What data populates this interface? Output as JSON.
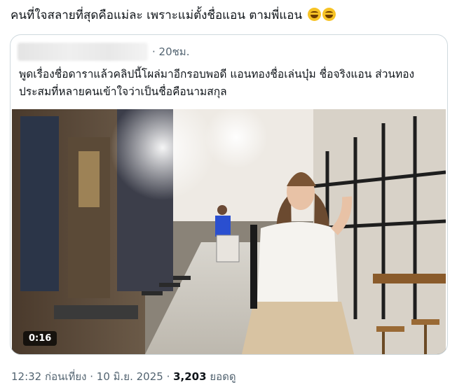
{
  "post": {
    "text": "คนที่ใจสลายที่สุดคือแม่ละ เพราะแม่ตั้งชื่อแอน ตามพี่แอน",
    "emojis": [
      "rolling-on-floor-laughing",
      "rolling-on-floor-laughing"
    ]
  },
  "quote": {
    "time": "· 20ชม.",
    "text": "พูดเรื่องชื่อดาราแล้วคลิปนี้โผล่มาอีกรอบพอดี แอนทองชื่อเล่นบุ๋ม ชื่อจริงแอน ส่วนทองประสมที่หลายคนเข้าใจว่าเป็นชื่อคือนามสกุล",
    "video": {
      "duration": "0:16"
    }
  },
  "meta": {
    "time": "12:32 ก่อนเที่ยง",
    "sep1": " · ",
    "date": "10 มิ.ย. 2025",
    "sep2": " · ",
    "views": "3,203",
    "views_label": " ยอดดู"
  },
  "colors": {
    "text": "#0f1419",
    "muted": "#536471",
    "border": "#cfd9de"
  }
}
